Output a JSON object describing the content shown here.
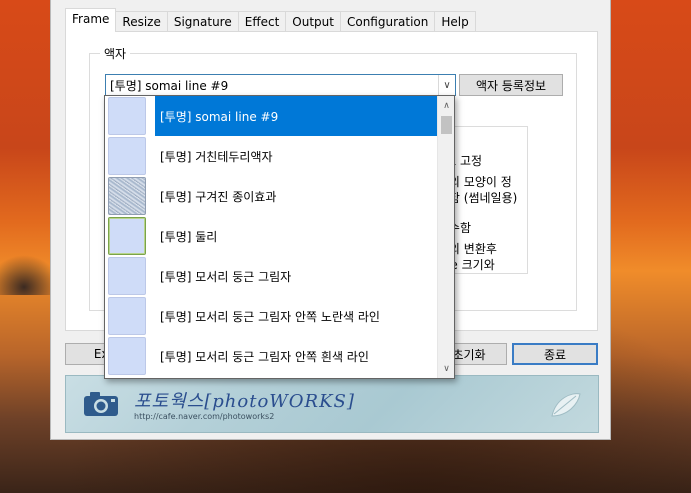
{
  "tabs": [
    "Frame",
    "Resize",
    "Signature",
    "Effect",
    "Output",
    "Configuration",
    "Help"
  ],
  "frame": {
    "group_label": "액자",
    "combo_value": "[투명] somai line #9",
    "register_button": "액자 등록정보"
  },
  "options_text": [
    "방형으로 고정",
    "한 사진의 모양이 정",
    "되도록 함 (썸네일용)",
    "항상 준수함",
    "한 사진의 변환후",
    "Ⅰ Resize 크기와"
  ],
  "bottom": {
    "exif_button": "Exif",
    "reset_button": "초기화",
    "close_button": "종료"
  },
  "banner": {
    "title": "포토웍스[photoWORKS]",
    "url": "http://cafe.naver.com/photoworks2"
  },
  "dropdown_items": [
    {
      "label": "[투명] somai line #9",
      "thumb": "plain",
      "selected": true
    },
    {
      "label": "[투명] 거친테두리액자",
      "thumb": "plain",
      "selected": false
    },
    {
      "label": "[투명] 구겨진 종이효과",
      "thumb": "rough",
      "selected": false
    },
    {
      "label": "[투명] 둘리",
      "thumb": "green",
      "selected": false
    },
    {
      "label": "[투명] 모서리 둥근 그림자",
      "thumb": "plain",
      "selected": false
    },
    {
      "label": "[투명] 모서리 둥근 그림자 안쪽 노란색 라인",
      "thumb": "plain",
      "selected": false
    },
    {
      "label": "[투명] 모서리 둥근 그림자 안쪽 흰색 라인",
      "thumb": "plain",
      "selected": false
    }
  ],
  "colors": {
    "selection": "#0078d7",
    "default_button_border": "#3a7cc5"
  }
}
